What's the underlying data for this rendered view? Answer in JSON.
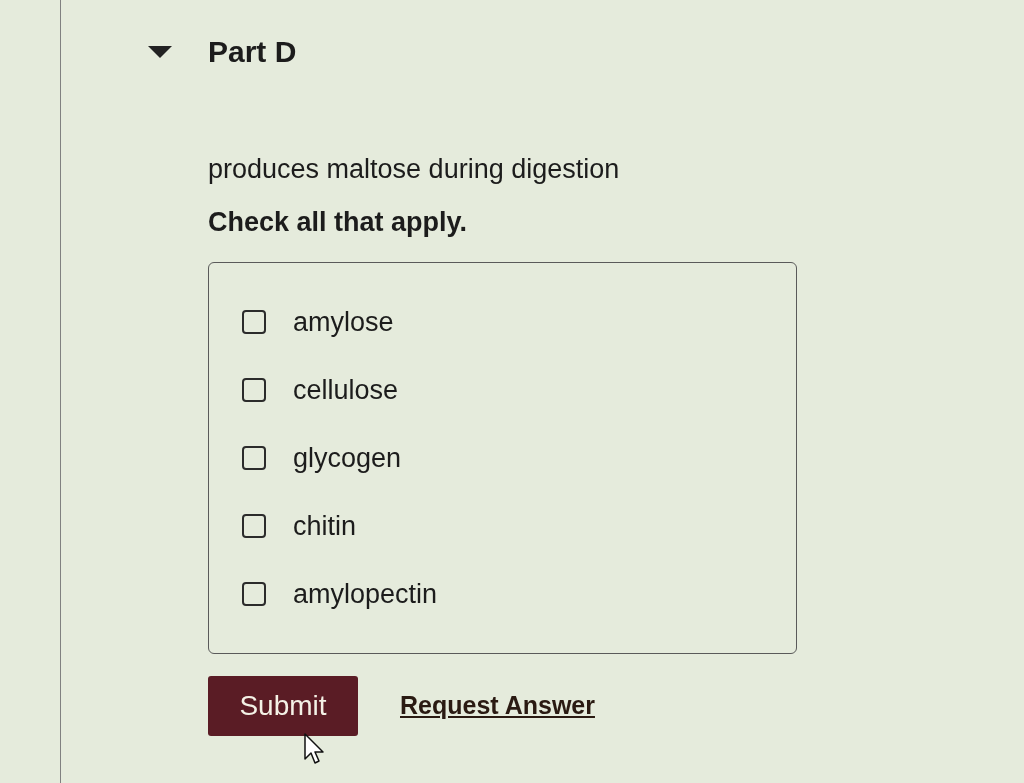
{
  "part": {
    "title": "Part D",
    "expanded": true
  },
  "question": {
    "prompt": "produces maltose during digestion",
    "instruction": "Check all that apply."
  },
  "options": [
    {
      "label": "amylose",
      "checked": false
    },
    {
      "label": "cellulose",
      "checked": false
    },
    {
      "label": "glycogen",
      "checked": false
    },
    {
      "label": "chitin",
      "checked": false
    },
    {
      "label": "amylopectin",
      "checked": false
    }
  ],
  "actions": {
    "submit": "Submit",
    "request_answer": "Request Answer"
  }
}
